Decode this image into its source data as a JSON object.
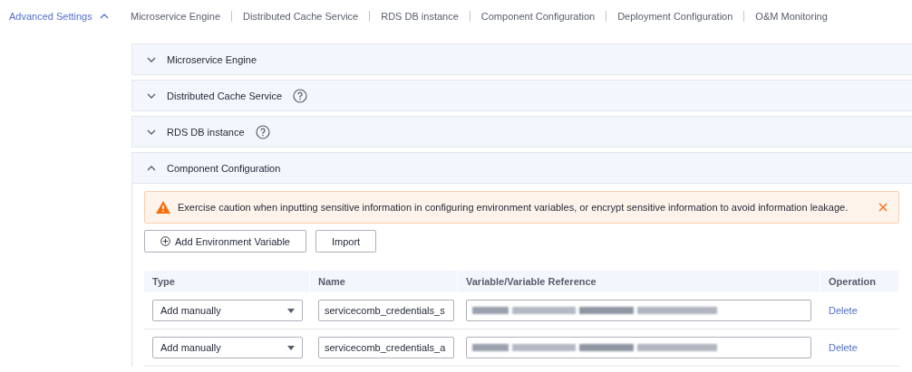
{
  "advanced_settings": {
    "label": "Advanced Settings",
    "expanded": true
  },
  "nav_links": [
    "Microservice Engine",
    "Distributed Cache Service",
    "RDS DB instance",
    "Component Configuration",
    "Deployment Configuration",
    "O&M Monitoring"
  ],
  "sections": [
    {
      "title": "Microservice Engine",
      "expanded": false,
      "help": false
    },
    {
      "title": "Distributed Cache Service",
      "expanded": false,
      "help": true
    },
    {
      "title": "RDS DB instance",
      "expanded": false,
      "help": true
    },
    {
      "title": "Component Configuration",
      "expanded": true,
      "help": false
    }
  ],
  "alert": {
    "message": "Exercise caution when inputting sensitive information in configuring environment variables, or encrypt sensitive information to avoid information leakage."
  },
  "buttons": [
    {
      "label": "Add Environment Variable",
      "kind": "add"
    },
    {
      "label": "Import",
      "kind": "plain"
    }
  ],
  "table": {
    "columns": [
      "Type",
      "Name",
      "Variable/Variable Reference",
      "Operation"
    ],
    "rows": [
      {
        "type": "Add manually",
        "name": "servicecomb_credentials_s",
        "action": "Delete"
      },
      {
        "type": "Add manually",
        "name": "servicecomb_credentials_a",
        "action": "Delete"
      }
    ]
  }
}
